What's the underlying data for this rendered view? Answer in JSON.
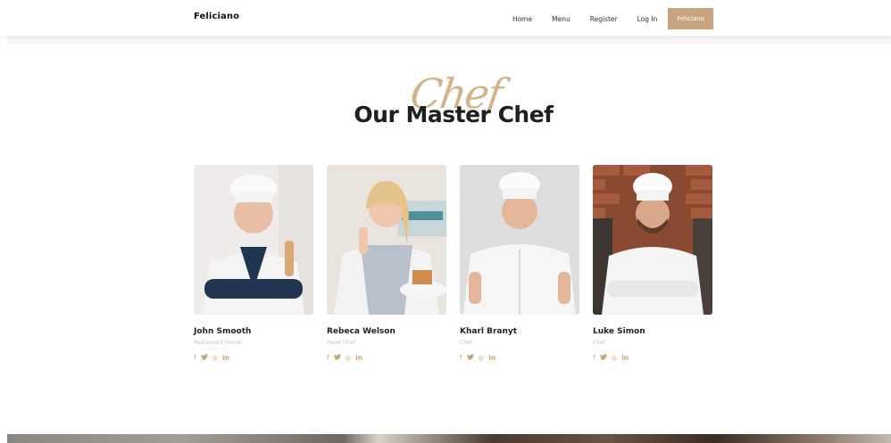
{
  "brand": "Feliciano",
  "nav": {
    "items": [
      "Home",
      "Menu",
      "Register",
      "Log In"
    ],
    "cta": "Feliciano"
  },
  "section": {
    "script_word": "Chef",
    "title": "Our Master Chef"
  },
  "chefs": [
    {
      "name": "John Smooth",
      "role": "Restaurant Owner"
    },
    {
      "name": "Rebeca Welson",
      "role": "Head Chef"
    },
    {
      "name": "Kharl Branyt",
      "role": "Chef"
    },
    {
      "name": "Luke Simon",
      "role": "Chef"
    }
  ],
  "social_icons": {
    "facebook": "f",
    "twitter": "🐦",
    "instagram": "◎",
    "linkedin": "in"
  },
  "colors": {
    "accent": "#c8a47e",
    "title": "#1f1f1f",
    "muted": "#c2c2c2"
  }
}
